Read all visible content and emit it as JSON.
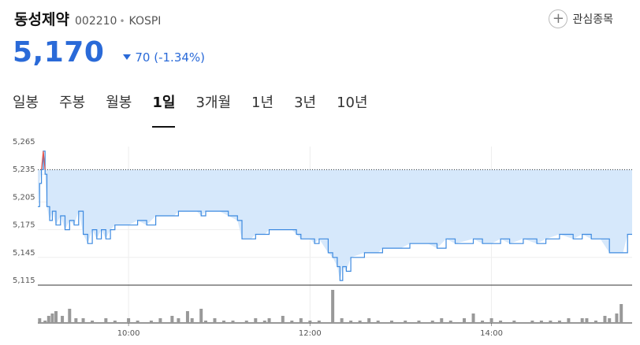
{
  "stock": {
    "name": "동성제약",
    "code": "002210",
    "market": "KOSPI",
    "price": "5,170",
    "change": "70",
    "change_pct": "(-1.34%)"
  },
  "watch_label": "관심종목",
  "tabs": [
    "일봉",
    "주봉",
    "월봉",
    "1일",
    "3개월",
    "1년",
    "3년",
    "10년"
  ],
  "active_tab": 3,
  "colors": {
    "down": "#2a6ad8",
    "up": "#e5534b",
    "area": "#d6e8fb",
    "volume": "#999999"
  },
  "icons": {
    "watch": "plus-circle-icon",
    "down": "down-triangle-icon"
  },
  "chart_data": {
    "type": "line",
    "y_ticks": [
      "5,265",
      "5,235",
      "5,205",
      "5,175",
      "5,145",
      "5,115"
    ],
    "x_ticks": [
      "10:00",
      "12:00",
      "14:00"
    ],
    "ylim": [
      5115,
      5265
    ],
    "prev_close": 5240,
    "grid": true,
    "series": [
      {
        "values": [
          [
            9.0,
            5200
          ],
          [
            9.02,
            5225
          ],
          [
            9.04,
            5240
          ],
          [
            9.06,
            5260
          ],
          [
            9.08,
            5235
          ],
          [
            9.1,
            5200
          ],
          [
            9.13,
            5185
          ],
          [
            9.16,
            5195
          ],
          [
            9.2,
            5180
          ],
          [
            9.25,
            5190
          ],
          [
            9.3,
            5175
          ],
          [
            9.35,
            5185
          ],
          [
            9.4,
            5180
          ],
          [
            9.45,
            5195
          ],
          [
            9.5,
            5170
          ],
          [
            9.55,
            5160
          ],
          [
            9.6,
            5175
          ],
          [
            9.65,
            5165
          ],
          [
            9.7,
            5175
          ],
          [
            9.75,
            5165
          ],
          [
            9.8,
            5175
          ],
          [
            9.85,
            5180
          ],
          [
            10.0,
            5180
          ],
          [
            10.1,
            5185
          ],
          [
            10.2,
            5180
          ],
          [
            10.3,
            5190
          ],
          [
            10.5,
            5190
          ],
          [
            10.55,
            5195
          ],
          [
            10.75,
            5195
          ],
          [
            10.8,
            5190
          ],
          [
            10.85,
            5195
          ],
          [
            11.0,
            5195
          ],
          [
            11.1,
            5190
          ],
          [
            11.2,
            5185
          ],
          [
            11.25,
            5165
          ],
          [
            11.35,
            5165
          ],
          [
            11.4,
            5170
          ],
          [
            11.5,
            5170
          ],
          [
            11.55,
            5175
          ],
          [
            11.8,
            5175
          ],
          [
            11.85,
            5170
          ],
          [
            11.9,
            5165
          ],
          [
            11.95,
            5165
          ],
          [
            12.0,
            5165
          ],
          [
            12.05,
            5160
          ],
          [
            12.1,
            5165
          ],
          [
            12.2,
            5150
          ],
          [
            12.25,
            5145
          ],
          [
            12.3,
            5135
          ],
          [
            12.33,
            5120
          ],
          [
            12.36,
            5135
          ],
          [
            12.4,
            5130
          ],
          [
            12.45,
            5145
          ],
          [
            12.6,
            5150
          ],
          [
            12.75,
            5150
          ],
          [
            12.8,
            5155
          ],
          [
            13.0,
            5155
          ],
          [
            13.1,
            5160
          ],
          [
            13.3,
            5160
          ],
          [
            13.4,
            5155
          ],
          [
            13.5,
            5165
          ],
          [
            13.6,
            5160
          ],
          [
            13.8,
            5165
          ],
          [
            13.9,
            5160
          ],
          [
            14.0,
            5160
          ],
          [
            14.1,
            5165
          ],
          [
            14.2,
            5160
          ],
          [
            14.35,
            5165
          ],
          [
            14.5,
            5160
          ],
          [
            14.6,
            5165
          ],
          [
            14.75,
            5170
          ],
          [
            14.9,
            5165
          ],
          [
            15.0,
            5170
          ],
          [
            15.1,
            5165
          ],
          [
            15.2,
            5165
          ],
          [
            15.3,
            5150
          ],
          [
            15.45,
            5150
          ],
          [
            15.5,
            5170
          ],
          [
            15.55,
            5170
          ]
        ]
      }
    ],
    "volume": [
      [
        9.02,
        2
      ],
      [
        9.08,
        1
      ],
      [
        9.12,
        3
      ],
      [
        9.16,
        4
      ],
      [
        9.2,
        5
      ],
      [
        9.27,
        3
      ],
      [
        9.35,
        6
      ],
      [
        9.42,
        2
      ],
      [
        9.5,
        2
      ],
      [
        9.6,
        1
      ],
      [
        9.75,
        2
      ],
      [
        9.85,
        1
      ],
      [
        10.0,
        2
      ],
      [
        10.1,
        1
      ],
      [
        10.25,
        1
      ],
      [
        10.35,
        2
      ],
      [
        10.48,
        3
      ],
      [
        10.55,
        2
      ],
      [
        10.65,
        5
      ],
      [
        10.7,
        2
      ],
      [
        10.8,
        6
      ],
      [
        10.85,
        1
      ],
      [
        10.95,
        2
      ],
      [
        11.05,
        1
      ],
      [
        11.15,
        1
      ],
      [
        11.3,
        1
      ],
      [
        11.4,
        2
      ],
      [
        11.5,
        1
      ],
      [
        11.55,
        2
      ],
      [
        11.7,
        3
      ],
      [
        11.8,
        1
      ],
      [
        11.9,
        2
      ],
      [
        12.0,
        1
      ],
      [
        12.1,
        1
      ],
      [
        12.25,
        14
      ],
      [
        12.35,
        2
      ],
      [
        12.45,
        1
      ],
      [
        12.55,
        1
      ],
      [
        12.65,
        2
      ],
      [
        12.75,
        1
      ],
      [
        12.9,
        1
      ],
      [
        13.05,
        1
      ],
      [
        13.2,
        1
      ],
      [
        13.35,
        1
      ],
      [
        13.45,
        2
      ],
      [
        13.55,
        1
      ],
      [
        13.7,
        2
      ],
      [
        13.8,
        4
      ],
      [
        13.9,
        1
      ],
      [
        14.0,
        2
      ],
      [
        14.1,
        1
      ],
      [
        14.25,
        1
      ],
      [
        14.45,
        1
      ],
      [
        14.55,
        1
      ],
      [
        14.65,
        1
      ],
      [
        14.75,
        1
      ],
      [
        14.85,
        2
      ],
      [
        15.0,
        2
      ],
      [
        15.05,
        2
      ],
      [
        15.15,
        1
      ],
      [
        15.25,
        3
      ],
      [
        15.3,
        2
      ],
      [
        15.38,
        4
      ],
      [
        15.43,
        8
      ]
    ]
  }
}
